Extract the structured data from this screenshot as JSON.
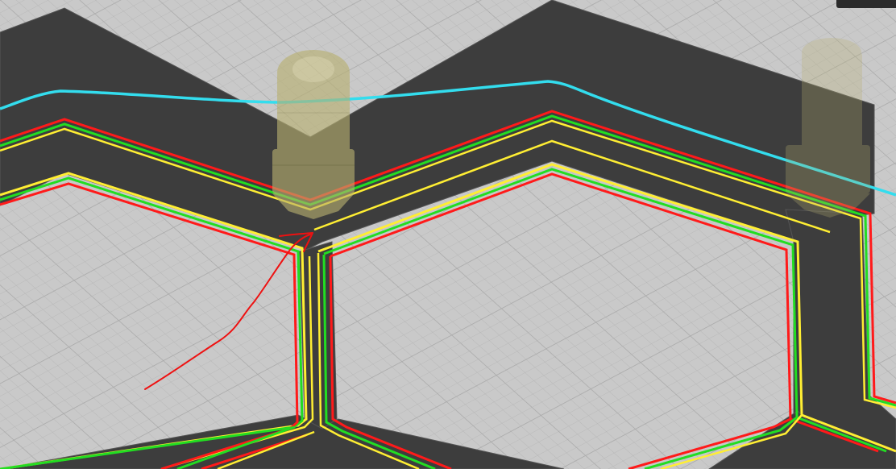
{
  "viewer": {
    "background_color": "#c9c9c9",
    "grid_color": "#b3b3b3",
    "model_color": "#3d3d3d",
    "model_edge_color": "#555555"
  },
  "toolpaths": {
    "outer_wall_color": "#ff1a1a",
    "inner_wall_color": "#22dd22",
    "skin_color": "#ffee33",
    "travel_color": "#33ddee"
  },
  "nozzle": {
    "color": "#b8b070"
  },
  "annotation": {
    "arrow_color": "#ee1111"
  },
  "corner_tab": {
    "color": "#2b2b2b"
  }
}
